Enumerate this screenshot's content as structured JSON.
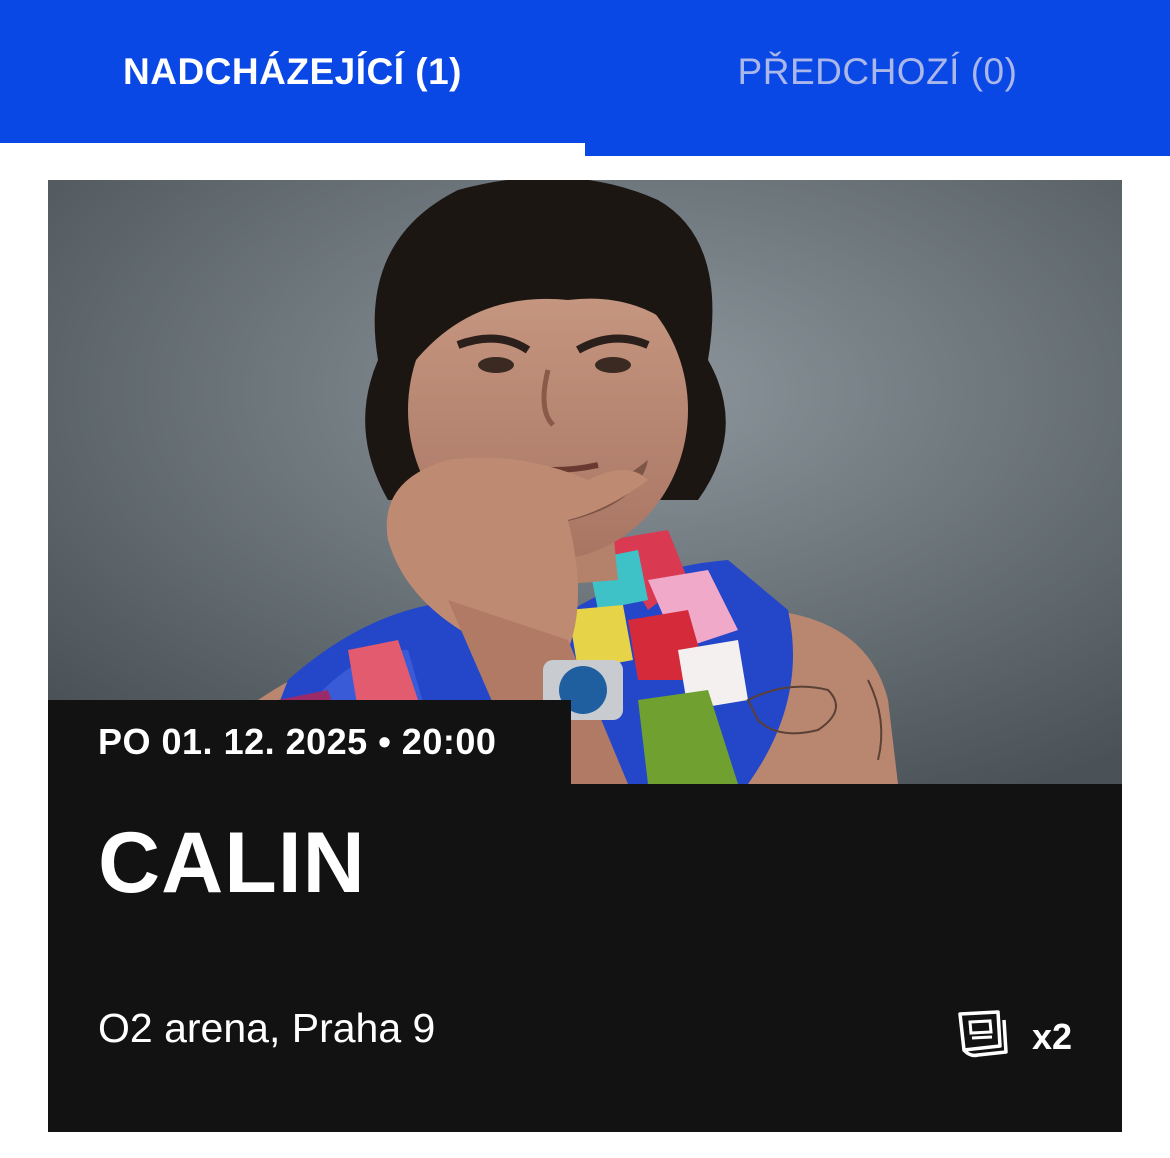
{
  "tabs": [
    {
      "label": "NADCHÁZEJÍCÍ (1)",
      "active": true
    },
    {
      "label": "PŘEDCHOZÍ (0)",
      "active": false
    }
  ],
  "event": {
    "datetime": "PO 01. 12. 2025 • 20:00",
    "title": "CALIN",
    "venue": "O2 arena, Praha 9",
    "ticket_icon": "ticket-stack-icon",
    "ticket_count": "x2"
  },
  "colors": {
    "accent": "#0a48e6",
    "inactive_tab_text": "#aab7e8",
    "card_bg": "#121212",
    "text_on_dark": "#ffffff"
  }
}
